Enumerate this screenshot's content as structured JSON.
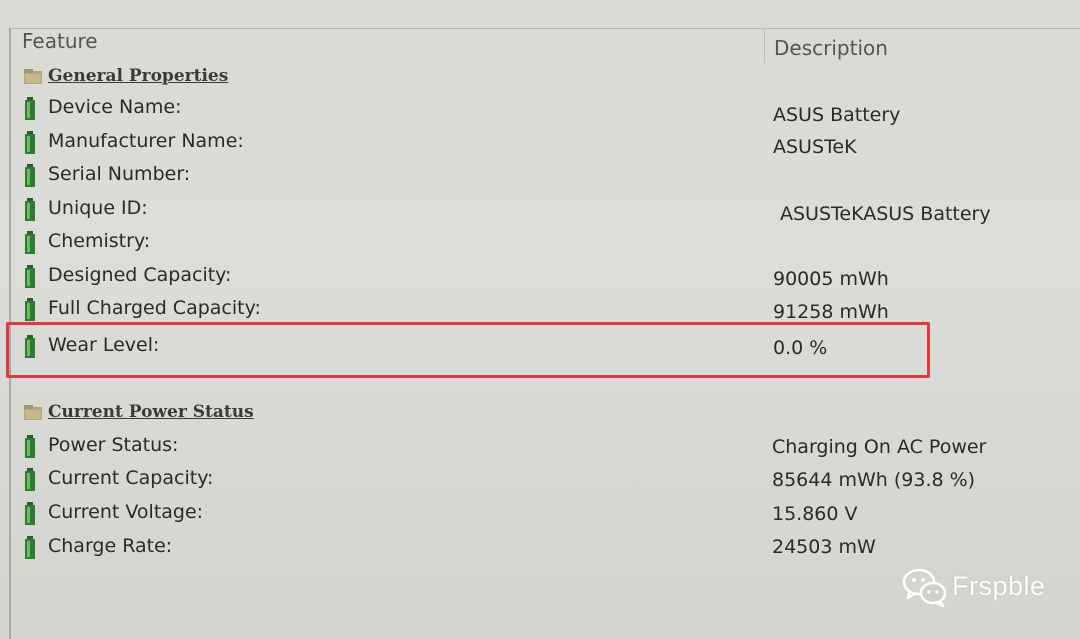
{
  "header": {
    "feature_label": "Feature",
    "description_label": "Description"
  },
  "sections": [
    {
      "title": "General Properties",
      "rows": [
        {
          "feature": "Device Name:",
          "description": "ASUS Battery"
        },
        {
          "feature": "Manufacturer Name:",
          "description": "ASUSTeK"
        },
        {
          "feature": "Serial Number:",
          "description": ""
        },
        {
          "feature": "Unique ID:",
          "description": "ASUSTeKASUS Battery"
        },
        {
          "feature": "Chemistry:",
          "description": ""
        },
        {
          "feature": "Designed Capacity:",
          "description": "90005 mWh"
        },
        {
          "feature": "Full Charged Capacity:",
          "description": "91258 mWh"
        },
        {
          "feature": "Wear Level:",
          "description": "0.0 %"
        }
      ]
    },
    {
      "title": "Current Power Status",
      "rows": [
        {
          "feature": "Power Status:",
          "description": "Charging On AC Power"
        },
        {
          "feature": "Current Capacity:",
          "description": "85644 mWh (93.8 %)"
        },
        {
          "feature": "Current Voltage:",
          "description": "15.860 V"
        },
        {
          "feature": "Charge Rate:",
          "description": "24503 mW"
        }
      ]
    }
  ],
  "highlight": {
    "color": "#e5383e"
  },
  "watermark": {
    "text": "Frspble"
  }
}
